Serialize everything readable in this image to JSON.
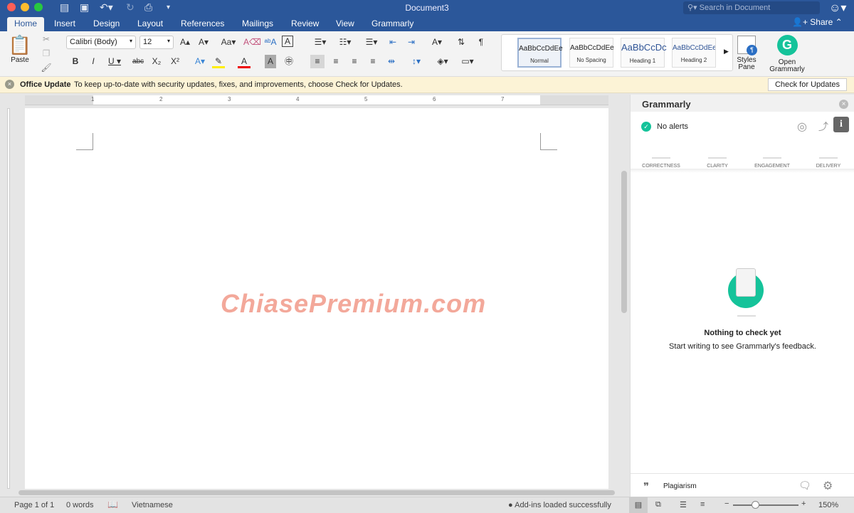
{
  "window": {
    "title": "Document3",
    "search_placeholder": "Search in Document",
    "share": "Share"
  },
  "tabs": [
    "Home",
    "Insert",
    "Design",
    "Layout",
    "References",
    "Mailings",
    "Review",
    "View",
    "Grammarly"
  ],
  "ribbon": {
    "paste": "Paste",
    "font": "Calibri (Body)",
    "size": "12",
    "styles": [
      {
        "sample": "AaBbCcDdEe",
        "label": "Normal"
      },
      {
        "sample": "AaBbCcDdEe",
        "label": "No Spacing"
      },
      {
        "sample": "AaBbCcDc",
        "label": "Heading 1"
      },
      {
        "sample": "AaBbCcDdEe",
        "label": "Heading 2"
      }
    ],
    "styles_pane": "Styles Pane",
    "open_grammarly": "Open Grammarly"
  },
  "update_bar": {
    "title": "Office Update",
    "message": "To keep up-to-date with security updates, fixes, and improvements, choose Check for Updates.",
    "button": "Check for Updates"
  },
  "ruler": [
    "1",
    "2",
    "3",
    "4",
    "5",
    "6",
    "7"
  ],
  "watermark": "ChiasePremium.com",
  "grammarly": {
    "title": "Grammarly",
    "alerts": "No alerts",
    "categories": [
      "CORRECTNESS",
      "CLARITY",
      "ENGAGEMENT",
      "DELIVERY"
    ],
    "empty_title": "Nothing to check yet",
    "empty_text": "Start writing to see Grammarly's feedback.",
    "plagiarism": "Plagiarism",
    "accent": "#15c39a"
  },
  "status": {
    "page": "Page 1 of 1",
    "words": "0 words",
    "language": "Vietnamese",
    "addins": "Add-ins loaded successfully",
    "zoom": "150%",
    "zoom_level_percent": 150
  }
}
